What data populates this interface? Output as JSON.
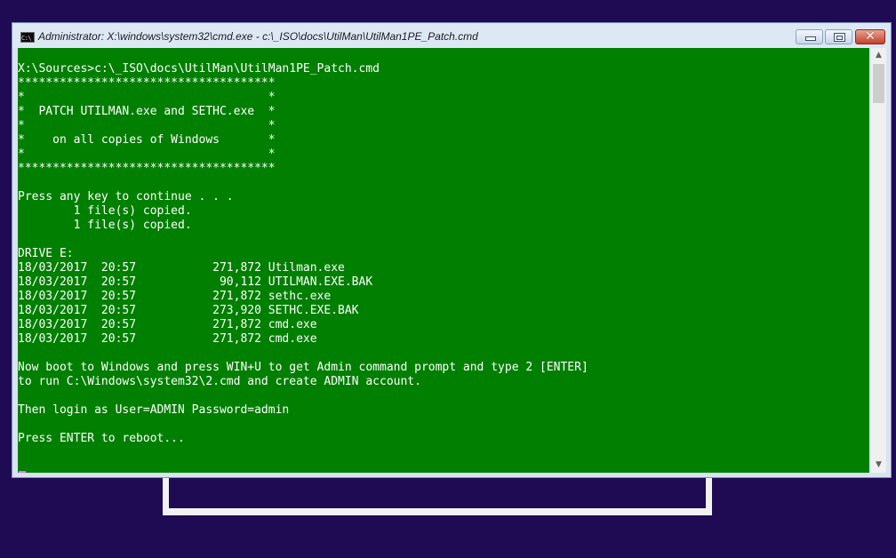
{
  "window": {
    "title": "Administrator: X:\\windows\\system32\\cmd.exe - c:\\_ISO\\docs\\UtilMan\\UtilMan1PE_Patch.cmd",
    "icon": "cmd-icon",
    "icon_text": "C:\\",
    "buttons": {
      "minimize": "minimize-icon",
      "maximize": "maximize-icon",
      "close": "close-icon",
      "close_glyph": "✕"
    }
  },
  "console": {
    "background": "#007f00",
    "foreground": "#ffffff",
    "lines": [
      "",
      "X:\\Sources>c:\\_ISO\\docs\\UtilMan\\UtilMan1PE_Patch.cmd",
      "*************************************",
      "*                                   *",
      "*  PATCH UTILMAN.exe and SETHC.exe  *",
      "*                                   *",
      "*    on all copies of Windows       *",
      "*                                   *",
      "*************************************",
      "",
      "Press any key to continue . . .",
      "        1 file(s) copied.",
      "        1 file(s) copied.",
      "",
      "DRIVE E:",
      "18/03/2017  20:57           271,872 Utilman.exe",
      "18/03/2017  20:57            90,112 UTILMAN.EXE.BAK",
      "18/03/2017  20:57           271,872 sethc.exe",
      "18/03/2017  20:57           273,920 SETHC.EXE.BAK",
      "18/03/2017  20:57           271,872 cmd.exe",
      "18/03/2017  20:57           271,872 cmd.exe",
      "",
      "Now boot to Windows and press WIN+U to get Admin command prompt and type 2 [ENTER]",
      "to run C:\\Windows\\system32\\2.cmd and create ADMIN account.",
      "",
      "Then login as User=ADMIN Password=admin",
      "",
      "Press ENTER to reboot..."
    ]
  },
  "scrollbar": {
    "up_glyph": "▲",
    "down_glyph": "▼"
  },
  "colors": {
    "desktop": "#1f0a54",
    "cursor": "#ff66ff"
  }
}
